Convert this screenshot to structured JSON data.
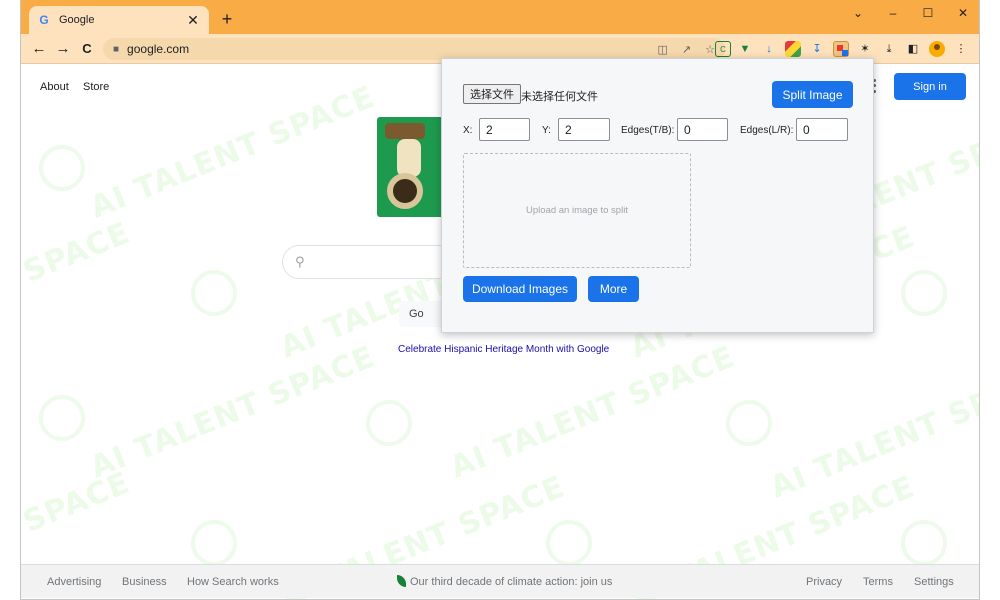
{
  "browser": {
    "tab": {
      "favicon": "G",
      "title": "Google",
      "close": "✕"
    },
    "new_tab": "+",
    "window_controls": {
      "dropdown": "⌄",
      "minimize": "–",
      "maximize": "☐",
      "close": "✕"
    },
    "nav": {
      "back": "←",
      "forward": "→",
      "reload": "C"
    },
    "omnibox": {
      "url": "google.com",
      "lock": "🔒"
    }
  },
  "google": {
    "top_links": {
      "about": "About",
      "store": "Store"
    },
    "sign_in": "Sign in",
    "search_button_partial": "Go",
    "celebrate_link": "Celebrate Hispanic Heritage Month with Google",
    "footer": {
      "advertising": "Advertising",
      "business": "Business",
      "how_search_works": "How Search works",
      "climate": "Our third decade of climate action: join us",
      "privacy": "Privacy",
      "terms": "Terms",
      "settings": "Settings"
    }
  },
  "watermark": {
    "text1": "AI TALENT SPACE",
    "text2": "SPACE"
  },
  "popup": {
    "file_button": "选择文件",
    "file_status": "未选择任何文件",
    "split_button": "Split Image",
    "fields": {
      "x_label": "X:",
      "x_value": "2",
      "y_label": "Y:",
      "y_value": "2",
      "tb_label": "Edges(T/B):",
      "tb_value": "0",
      "lr_label": "Edges(L/R):",
      "lr_value": "0"
    },
    "dropzone_text": "Upload an image to split",
    "download_button": "Download Images",
    "more_button": "More"
  },
  "colors": {
    "tabstrip": "#f9ab45",
    "toolbar": "#fde2bd",
    "primary_blue": "#1a73e8",
    "link_blue": "#1a0dab"
  }
}
